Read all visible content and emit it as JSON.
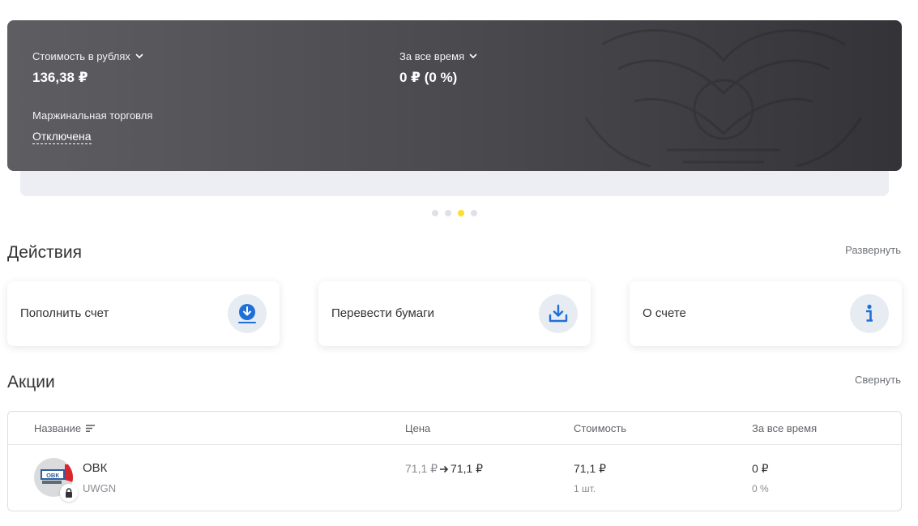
{
  "account": {
    "value_label": "Стоимость в рублях",
    "value": "136,38 ₽",
    "period_label": "За все время",
    "period_value": "0 ₽ (0 %)",
    "margin_label": "Маржинальная торговля",
    "margin_status": "Отключена"
  },
  "carousel": {
    "count": 4,
    "active_index": 2
  },
  "actions": {
    "title": "Действия",
    "toggle": "Развернуть",
    "items": [
      {
        "label": "Пополнить счет",
        "icon": "deposit-icon"
      },
      {
        "label": "Перевести бумаги",
        "icon": "transfer-download-icon"
      },
      {
        "label": "О счете",
        "icon": "info-icon"
      }
    ]
  },
  "stocks": {
    "title": "Акции",
    "toggle": "Свернуть",
    "columns": [
      "Название",
      "Цена",
      "Стоимость",
      "За все время"
    ],
    "rows": [
      {
        "name": "ОВК",
        "ticker": "UWGN",
        "logo_text": "ОВК",
        "price_from": "71,1 ₽",
        "price_to": "71,1 ₽",
        "value": "71,1 ₽",
        "quantity": "1 шт.",
        "total_change": "0 ₽",
        "total_change_pct": "0 %"
      }
    ]
  },
  "colors": {
    "accent_yellow": "#ffdd2d",
    "icon_blue": "#1f6fd8",
    "card_dark": "#48484d"
  }
}
